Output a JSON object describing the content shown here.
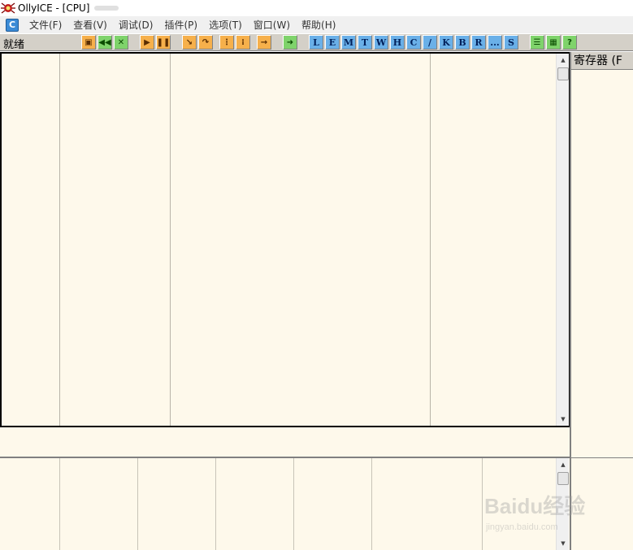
{
  "window": {
    "title": "OllyICE - [CPU]"
  },
  "menu": {
    "mdi_icon_label": "C",
    "items": [
      "文件(F)",
      "查看(V)",
      "调试(D)",
      "插件(P)",
      "选项(T)",
      "窗口(W)",
      "帮助(H)"
    ]
  },
  "toolbar": {
    "status": "就绪",
    "group1": [
      {
        "icon": "open-icon"
      },
      {
        "icon": "restart-icon"
      },
      {
        "icon": "close-icon"
      }
    ],
    "group2": [
      {
        "icon": "run-icon"
      },
      {
        "icon": "pause-icon"
      }
    ],
    "group3": [
      {
        "icon": "step-into-icon"
      },
      {
        "icon": "step-over-icon"
      },
      {
        "icon": "trace-into-icon"
      },
      {
        "icon": "trace-over-icon"
      },
      {
        "icon": "execute-till-return-icon"
      }
    ],
    "group4": [
      {
        "icon": "goto-icon"
      }
    ],
    "letters": [
      "L",
      "E",
      "M",
      "T",
      "W",
      "H",
      "C",
      "/",
      "K",
      "B",
      "R",
      "...",
      "S"
    ],
    "group5": [
      {
        "icon": "list-icon"
      },
      {
        "icon": "grid-icon"
      },
      {
        "icon": "help-icon"
      }
    ]
  },
  "registers": {
    "header": "寄存器 (F"
  },
  "watermark": {
    "brand": "Baidu经验",
    "url": "jingyan.baidu.com"
  },
  "colors": {
    "pane_bg": "#fef9eb",
    "toolbar_bg": "#d4d0c8",
    "accent_blue": "#6ab0e8",
    "accent_green": "#7fd36b",
    "accent_orange": "#f6b04b"
  }
}
